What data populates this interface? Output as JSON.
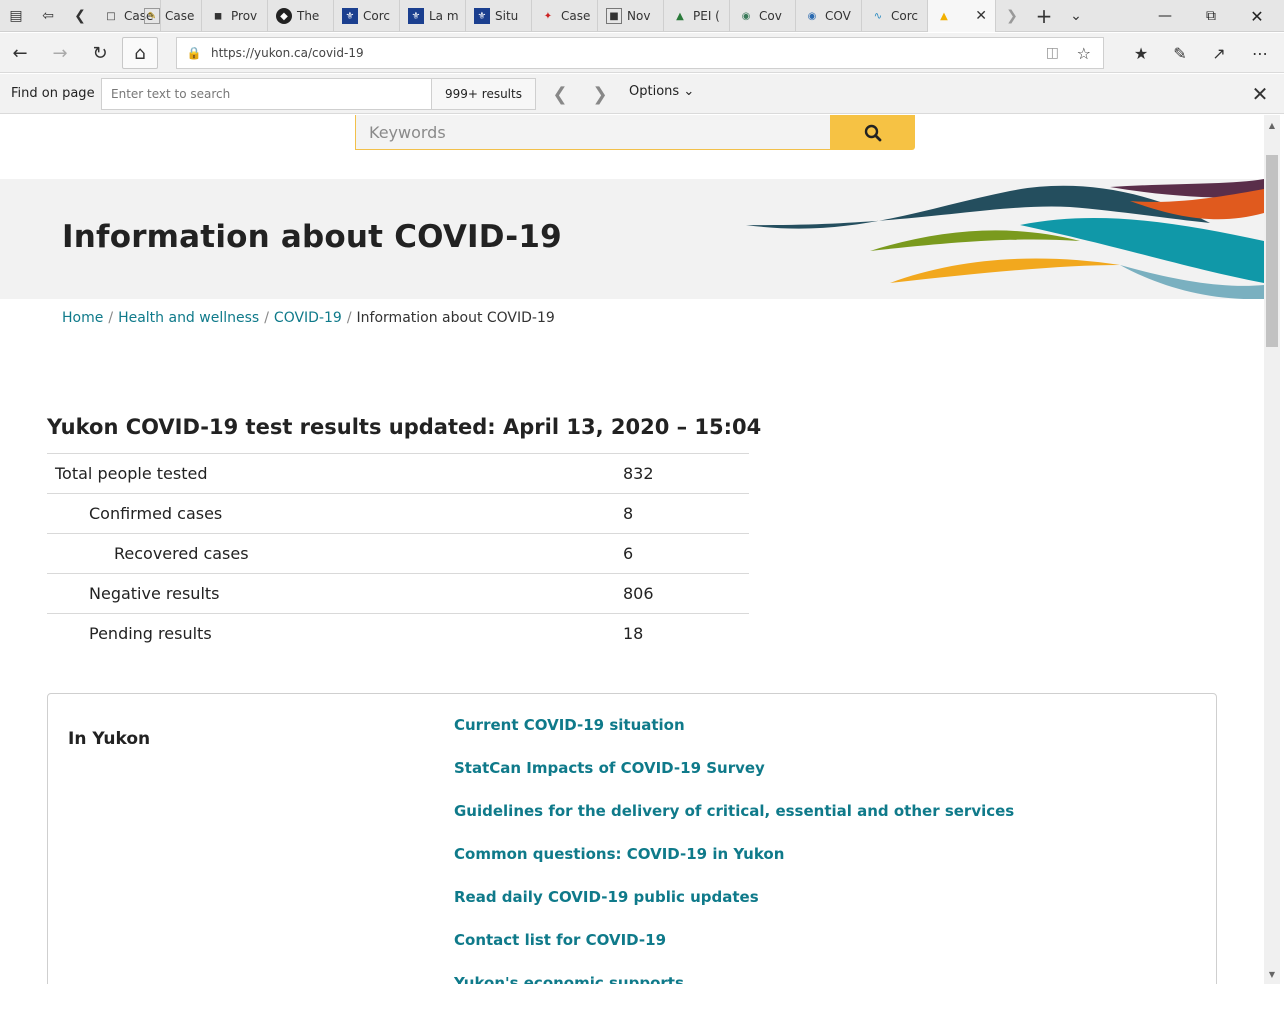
{
  "tabs": [
    {
      "label": "Case",
      "icon": "page-icon"
    },
    {
      "label": "Case",
      "icon": "document-icon"
    },
    {
      "label": "Prov",
      "icon": "bison-icon"
    },
    {
      "label": "The",
      "icon": "shield-icon"
    },
    {
      "label": "Corc",
      "icon": "fleur-de-lis-icon"
    },
    {
      "label": "La m",
      "icon": "fleur-de-lis-icon"
    },
    {
      "label": "Situ",
      "icon": "fleur-de-lis-icon"
    },
    {
      "label": "Case",
      "icon": "feather-icon"
    },
    {
      "label": "Nov",
      "icon": "newspaper-icon"
    },
    {
      "label": "PEI (",
      "icon": "island-icon"
    },
    {
      "label": "Cov",
      "icon": "globe-icon"
    },
    {
      "label": "COV",
      "icon": "emblem-icon"
    },
    {
      "label": "Corc",
      "icon": "wave-icon"
    }
  ],
  "active_tab": {
    "icon": "sunrise-icon"
  },
  "address": {
    "url": "https://yukon.ca/covid-19"
  },
  "find": {
    "label": "Find on page",
    "placeholder": "Enter text to search",
    "count": "999+ results",
    "options": "Options"
  },
  "site": {
    "search_placeholder": "Keywords",
    "page_title": "Information about COVID-19",
    "breadcrumb": [
      "Home",
      "Health and wellness",
      "COVID-19",
      "Information about COVID-19"
    ],
    "results": {
      "title": "Yukon COVID-19 test results updated: April 13, 2020 – 15:04",
      "rows": [
        {
          "label": "Total people tested",
          "value": "832"
        },
        {
          "label": "Confirmed cases",
          "value": "8"
        },
        {
          "label": "Recovered cases",
          "value": "6"
        },
        {
          "label": "Negative results",
          "value": "806"
        },
        {
          "label": "Pending results",
          "value": "18"
        }
      ]
    },
    "panel": {
      "heading": "In Yukon",
      "links": [
        "Current COVID-19 situation",
        "StatCan Impacts of COVID-19 Survey",
        "Guidelines for the delivery of critical, essential and other services",
        "Common questions: COVID-19 in Yukon",
        "Read daily COVID-19 public updates",
        "Contact list for COVID-19",
        "Yukon's economic supports"
      ]
    }
  },
  "colors": {
    "link": "#0f7a8a",
    "search_button": "#f6c244",
    "hero_bg": "#f2f2f2"
  }
}
